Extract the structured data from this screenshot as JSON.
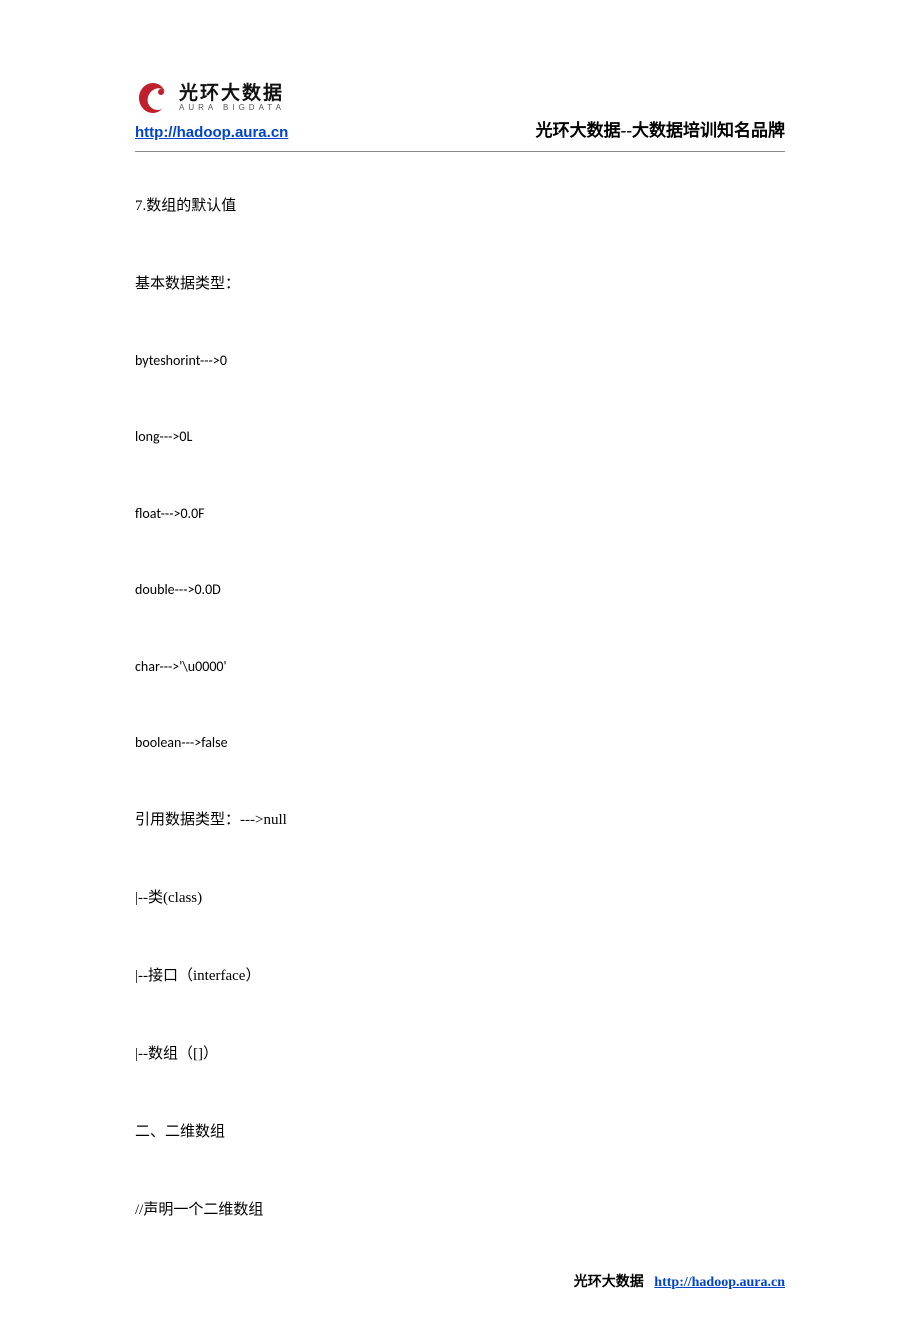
{
  "header": {
    "logo_cn": "光环大数据",
    "logo_en": "AURA  BIGDATA",
    "header_url": "http://hadoop.aura.cn",
    "header_title": "光环大数据--大数据培训知名品牌"
  },
  "content": {
    "p1": "7.数组的默认值",
    "p2": "基本数据类型：",
    "p3": "byteshorint--->0",
    "p4": "long--->0L",
    "p5": "float--->0.0F",
    "p6": "double--->0.0D",
    "p7": "char--->'\\u0000'",
    "p8": "boolean--->false",
    "p9": "引用数据类型：--->null",
    "p10": "|--类(class)",
    "p11": "|--接口（interface）",
    "p12": "|--数组（[]）",
    "p13": "二、二维数组",
    "p14": "//声明一个二维数组"
  },
  "footer": {
    "label": "光环大数据",
    "url": "http://hadoop.aura.cn"
  }
}
